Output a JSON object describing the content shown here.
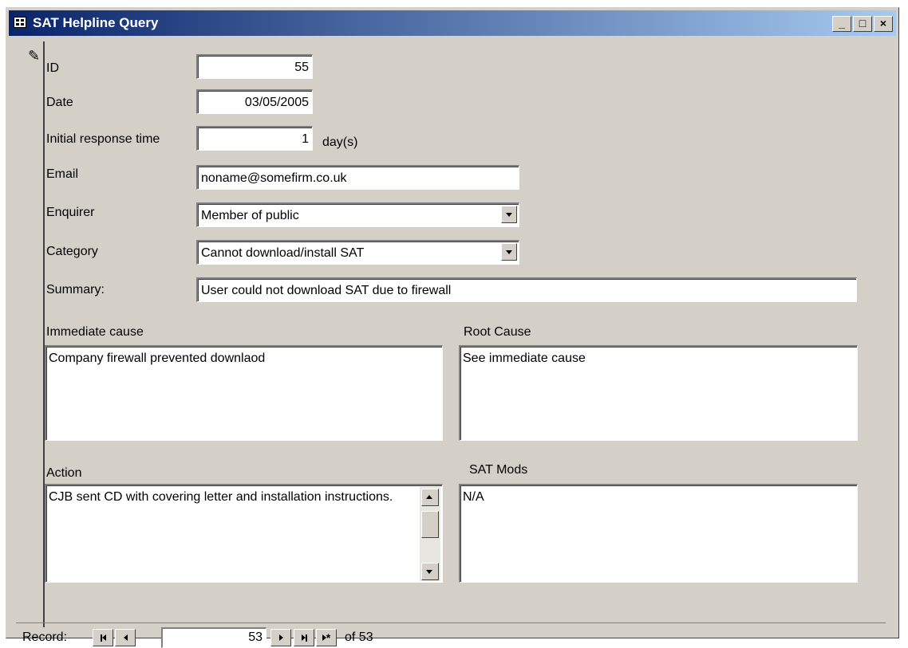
{
  "window": {
    "title": "SAT Helpline Query"
  },
  "titlebar_buttons": {
    "minimize": "_",
    "maximize": "□",
    "close": "×"
  },
  "form": {
    "id_label": "ID",
    "id_value": "55",
    "date_label": "Date",
    "date_value": "03/05/2005",
    "response_label": "Initial response time",
    "response_value": "1",
    "response_unit": "day(s)",
    "email_label": "Email",
    "email_value": "noname@somefirm.co.uk",
    "enquirer_label": "Enquirer",
    "enquirer_value": "Member of public",
    "category_label": "Category",
    "category_value": "Cannot download/install SAT",
    "summary_label": "Summary:",
    "summary_value": "User could not download SAT due to firewall",
    "immediate_cause_label": "Immediate cause",
    "immediate_cause_value": "Company firewall prevented downlaod",
    "root_cause_label": "Root Cause",
    "root_cause_value": "See immediate cause",
    "action_label": "Action",
    "action_value": "CJB sent CD with covering letter and installation instructions.",
    "sat_mods_label": "SAT Mods",
    "sat_mods_value": "N/A"
  },
  "navigation": {
    "record_label": "Record:",
    "current_record": "53",
    "of_label": "of 53"
  },
  "icons": {
    "record_selector": "pencil-icon",
    "window_icon": "form-icon"
  }
}
